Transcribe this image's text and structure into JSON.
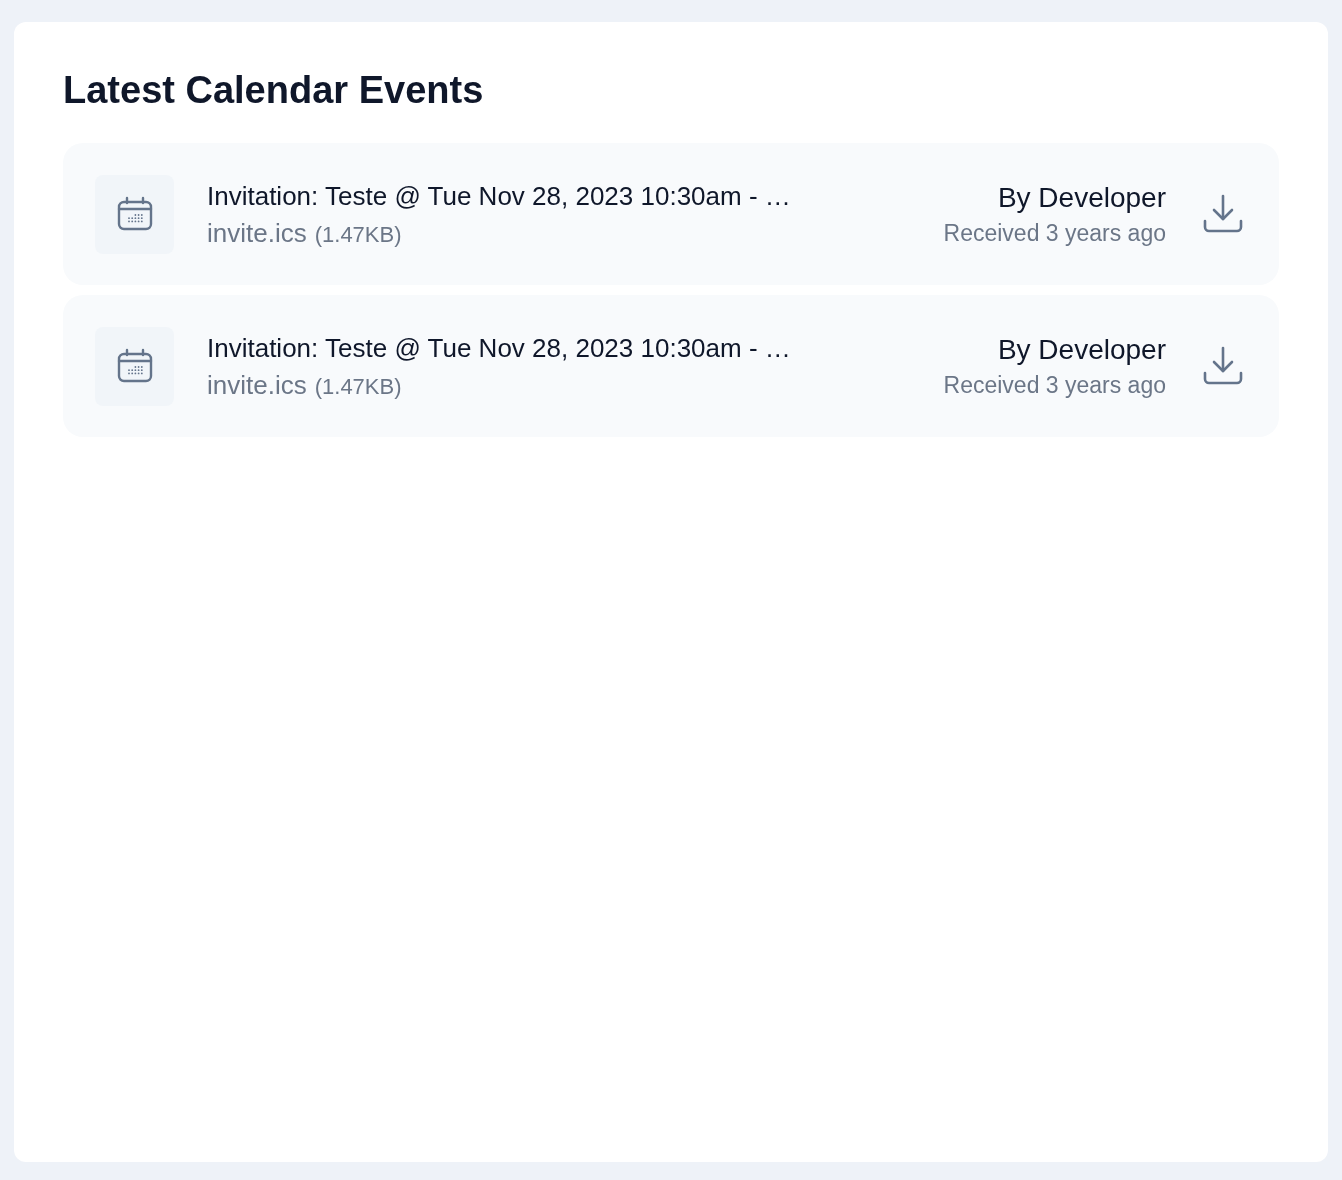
{
  "panel": {
    "title": "Latest Calendar Events"
  },
  "events": [
    {
      "title": "Invitation: Teste @ Tue Nov 28, 2023 10:30am - …",
      "file_name": "invite.ics",
      "file_size": "(1.47KB)",
      "sender": "By Developer",
      "received": "Received 3 years ago"
    },
    {
      "title": "Invitation: Teste @ Tue Nov 28, 2023 10:30am - …",
      "file_name": "invite.ics",
      "file_size": "(1.47KB)",
      "sender": "By Developer",
      "received": "Received 3 years ago"
    }
  ]
}
